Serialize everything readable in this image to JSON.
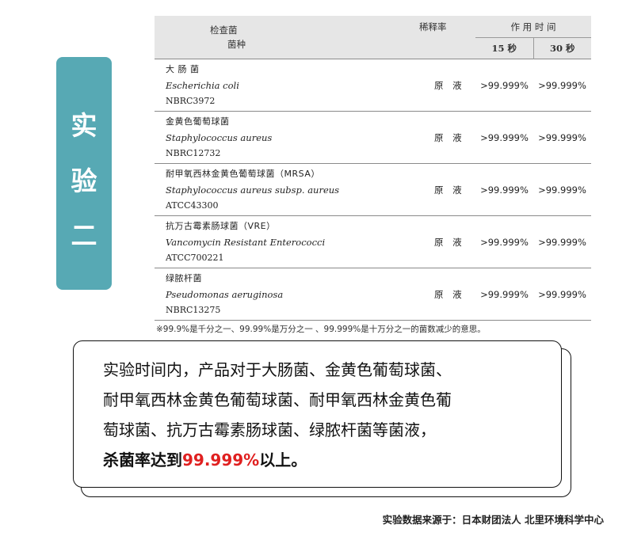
{
  "side_label": [
    "实",
    "验",
    "二"
  ],
  "table": {
    "header": {
      "strain_line1": "检查菌",
      "strain_line2": "菌种",
      "dilution": "稀释率",
      "time": "作 用 时 间",
      "t15": "15 秒",
      "t30": "30 秒"
    },
    "rows": [
      {
        "cn": "大 肠 菌",
        "sci": "Escherichia coli",
        "code": "NBRC3972",
        "dilution": "原 液",
        "v15": ">99.999%",
        "v30": ">99.999%"
      },
      {
        "cn": "金黄色葡萄球菌",
        "sci": "Staphylococcus aureus",
        "code": "NBRC12732",
        "dilution": "原 液",
        "v15": ">99.999%",
        "v30": ">99.999%"
      },
      {
        "cn": "耐甲氧西林金黄色葡萄球菌（MRSA）",
        "sci": "Staphylococcus aureus subsp. aureus",
        "code": "ATCC43300",
        "dilution": "原 液",
        "v15": ">99.999%",
        "v30": ">99.999%"
      },
      {
        "cn": "抗万古霉素肠球菌（VRE）",
        "sci": "Vancomycin Resistant Enterococci",
        "code": "ATCC700221",
        "dilution": "原 液",
        "v15": ">99.999%",
        "v30": ">99.999%"
      },
      {
        "cn": "绿脓杆菌",
        "sci": "Pseudomonas aeruginosa",
        "code": "NBRC13275",
        "dilution": "原 液",
        "v15": ">99.999%",
        "v30": ">99.999%"
      }
    ],
    "note": "※99.9%是千分之一、99.99%是万分之一 、99.999%是十万分之一的菌数减少的意思。"
  },
  "callout": {
    "line1": "实验时间内，产品对于大肠菌、金黄色葡萄球菌、",
    "line2": "耐甲氧西林金黄色葡萄球菌、耐甲氧西林金黄色葡",
    "line3": "萄球菌、抗万古霉素肠球菌、绿脓杆菌等菌液，",
    "line4_prefix": "杀菌率达到",
    "line4_value": "99.999%",
    "line4_suffix": "以上。"
  },
  "source": "实验数据来源于：日本财团法人 北里环境科学中心",
  "colors": {
    "badge": "#57a9b4",
    "header_bg": "#e6e6e6",
    "highlight": "#e02020"
  }
}
